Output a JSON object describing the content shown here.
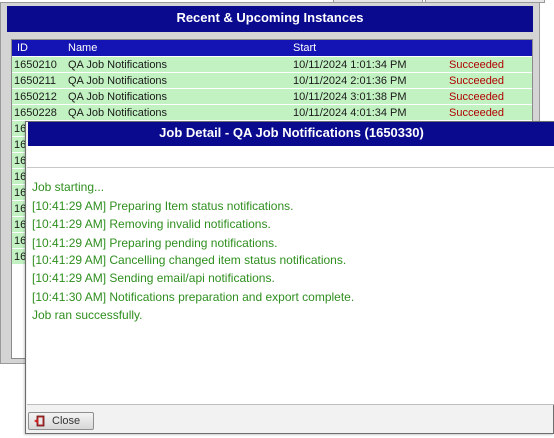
{
  "background_window": {
    "title": "Recent & Upcoming Instances",
    "columns": [
      "ID",
      "Name",
      "Start"
    ],
    "rows": [
      {
        "id": "1650210",
        "name": "QA Job Notifications",
        "start": "10/11/2024 1:01:34 PM",
        "status": "Succeeded"
      },
      {
        "id": "1650211",
        "name": "QA Job Notifications",
        "start": "10/11/2024 2:01:36 PM",
        "status": "Succeeded"
      },
      {
        "id": "1650212",
        "name": "QA Job Notifications",
        "start": "10/11/2024 3:01:38 PM",
        "status": "Succeeded"
      },
      {
        "id": "1650228",
        "name": "QA Job Notifications",
        "start": "10/11/2024 4:01:34 PM",
        "status": "Succeeded"
      }
    ],
    "partial_row_ids": [
      "16",
      "16",
      "16",
      "16",
      "16",
      "16",
      "16",
      "16",
      "16"
    ]
  },
  "dialog": {
    "title": "Job Detail - QA Job Notifications (1650330)",
    "log_lines": [
      "Job starting...",
      "[10:41:29 AM] Preparing Item status notifications.",
      "[10:41:29 AM] Removing invalid notifications.",
      "[10:41:29 AM] Preparing pending notifications.",
      "[10:41:29 AM] Cancelling changed item status notifications.",
      "[10:41:29 AM] Sending email/api notifications.",
      "[10:41:30 AM] Notifications preparation and export complete.",
      "Job ran successfully."
    ],
    "close_label": "Close"
  },
  "colors": {
    "title_bar": "#0a0a8f",
    "grid_header": "#1414b4",
    "row_green": "#c2f2c2",
    "status_red": "#b00000",
    "log_green": "#2f8f1f"
  }
}
